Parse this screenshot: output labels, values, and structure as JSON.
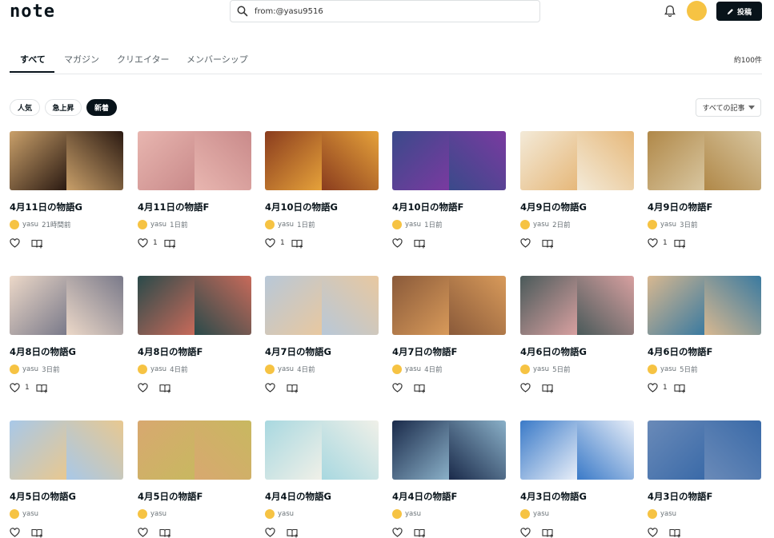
{
  "header": {
    "logo": "note",
    "search_value": "from:@yasu9516",
    "post_label": "投稿"
  },
  "tabs": {
    "items": [
      "すべて",
      "マガジン",
      "クリエイター",
      "メンバーシップ"
    ],
    "count": "約100件"
  },
  "filters": [
    "人気",
    "急上昇",
    "新着"
  ],
  "sort_label": "すべての記事",
  "cards": [
    {
      "title": "4月11日の物語G",
      "author": "yasu",
      "time": "21時間前",
      "likes": "",
      "c1": "#c9a06a",
      "c2": "#2b1a12"
    },
    {
      "title": "4月11日の物語F",
      "author": "yasu",
      "time": "1日前",
      "likes": "1",
      "c1": "#e8b6b0",
      "c2": "#c98a8a"
    },
    {
      "title": "4月10日の物語G",
      "author": "yasu",
      "time": "1日前",
      "likes": "1",
      "c1": "#8a3c1e",
      "c2": "#e6a23a"
    },
    {
      "title": "4月10日の物語F",
      "author": "yasu",
      "time": "1日前",
      "likes": "",
      "c1": "#3a4a8a",
      "c2": "#7a3aa0"
    },
    {
      "title": "4月9日の物語G",
      "author": "yasu",
      "time": "2日前",
      "likes": "",
      "c1": "#f3ead8",
      "c2": "#e6b87a"
    },
    {
      "title": "4月9日の物語F",
      "author": "yasu",
      "time": "3日前",
      "likes": "1",
      "c1": "#b08848",
      "c2": "#d8c6a0"
    },
    {
      "title": "4月8日の物語G",
      "author": "yasu",
      "time": "3日前",
      "likes": "1",
      "c1": "#ecd8c8",
      "c2": "#7a7a8a"
    },
    {
      "title": "4月8日の物語F",
      "author": "yasu",
      "time": "4日前",
      "likes": "",
      "c1": "#2a4a4a",
      "c2": "#c86a5a"
    },
    {
      "title": "4月7日の物語G",
      "author": "yasu",
      "time": "4日前",
      "likes": "",
      "c1": "#b8c8d8",
      "c2": "#e8c8a0"
    },
    {
      "title": "4月7日の物語F",
      "author": "yasu",
      "time": "4日前",
      "likes": "",
      "c1": "#8a5a3a",
      "c2": "#d89a5a"
    },
    {
      "title": "4月6日の物語G",
      "author": "yasu",
      "time": "5日前",
      "likes": "",
      "c1": "#4a5a5a",
      "c2": "#d8a0a0"
    },
    {
      "title": "4月6日の物語F",
      "author": "yasu",
      "time": "5日前",
      "likes": "1",
      "c1": "#d8b890",
      "c2": "#3a7aa0"
    },
    {
      "title": "4月5日の物語G",
      "author": "yasu",
      "time": "",
      "likes": "",
      "c1": "#a8c8e8",
      "c2": "#e8c890"
    },
    {
      "title": "4月5日の物語F",
      "author": "yasu",
      "time": "",
      "likes": "",
      "c1": "#d8a870",
      "c2": "#c8b860"
    },
    {
      "title": "4月4日の物語G",
      "author": "yasu",
      "time": "",
      "likes": "",
      "c1": "#a8d8e0",
      "c2": "#f0f0e8"
    },
    {
      "title": "4月4日の物語F",
      "author": "yasu",
      "time": "",
      "likes": "",
      "c1": "#1a2a4a",
      "c2": "#8ab0c8"
    },
    {
      "title": "4月3日の物語G",
      "author": "yasu",
      "time": "",
      "likes": "",
      "c1": "#3a7ac8",
      "c2": "#e8eef8"
    },
    {
      "title": "4月3日の物語F",
      "author": "yasu",
      "time": "",
      "likes": "",
      "c1": "#6a8ab8",
      "c2": "#3a6aa8"
    }
  ]
}
